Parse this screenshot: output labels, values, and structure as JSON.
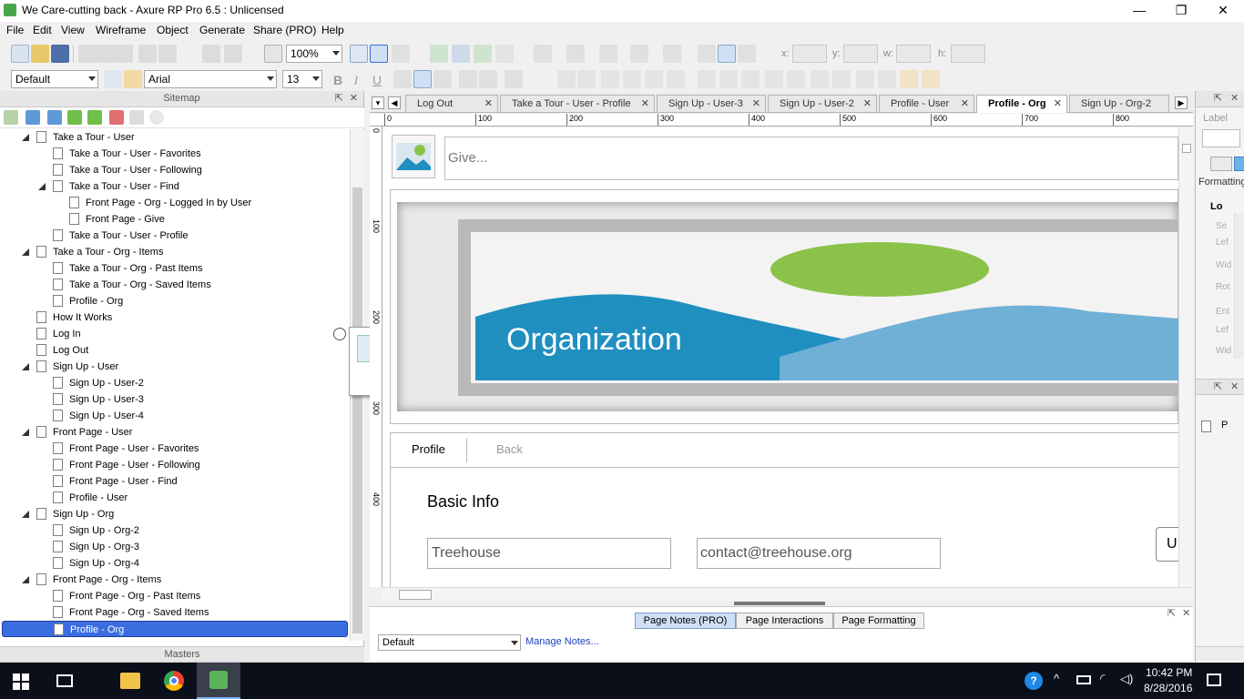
{
  "window": {
    "title": "We Care-cutting back - Axure RP Pro 6.5 : Unlicensed",
    "minimize": "—",
    "restore": "❐",
    "close": "✕"
  },
  "menu": [
    "File",
    "Edit",
    "View",
    "Wireframe",
    "Object",
    "Generate",
    "Share (PRO)",
    "Help"
  ],
  "toolbar": {
    "zoom": "100%",
    "style_combo": "Default",
    "font_combo": "Arial",
    "size_combo": "13",
    "bold": "B",
    "italic": "I",
    "underline": "U",
    "x_label": "x:",
    "y_label": "y:",
    "w_label": "w:",
    "h_label": "h:"
  },
  "sitemap": {
    "header": "Sitemap",
    "items": [
      {
        "label": "Take a Tour - User",
        "level": 1,
        "expanded": true
      },
      {
        "label": "Take a Tour - User - Favorites",
        "level": 2
      },
      {
        "label": "Take a Tour - User - Following",
        "level": 2
      },
      {
        "label": "Take a Tour - User - Find",
        "level": 2,
        "expanded": true
      },
      {
        "label": "Front Page - Org - Logged In by User",
        "level": 3
      },
      {
        "label": "Front Page - Give",
        "level": 3
      },
      {
        "label": "Take a Tour - User - Profile",
        "level": 2
      },
      {
        "label": "Take a Tour - Org - Items",
        "level": 1,
        "expanded": true
      },
      {
        "label": "Take a Tour - Org - Past Items",
        "level": 2
      },
      {
        "label": "Take a Tour - Org - Saved Items",
        "level": 2
      },
      {
        "label": "Profile - Org",
        "level": 2
      },
      {
        "label": "How It Works",
        "level": 1
      },
      {
        "label": "Log In",
        "level": 1
      },
      {
        "label": "Log Out",
        "level": 1
      },
      {
        "label": "Sign Up - User",
        "level": 1,
        "expanded": true
      },
      {
        "label": "Sign Up - User-2",
        "level": 2
      },
      {
        "label": "Sign Up - User-3",
        "level": 2
      },
      {
        "label": "Sign Up - User-4",
        "level": 2
      },
      {
        "label": "Front Page - User",
        "level": 1,
        "expanded": true
      },
      {
        "label": "Front Page - User - Favorites",
        "level": 2
      },
      {
        "label": "Front Page - User - Following",
        "level": 2
      },
      {
        "label": "Front Page - User - Find",
        "level": 2
      },
      {
        "label": "Profile - User",
        "level": 2
      },
      {
        "label": "Sign Up - Org",
        "level": 1,
        "expanded": true
      },
      {
        "label": "Sign Up - Org-2",
        "level": 2
      },
      {
        "label": "Sign Up - Org-3",
        "level": 2
      },
      {
        "label": "Sign Up - Org-4",
        "level": 2
      },
      {
        "label": "Front Page - Org - Items",
        "level": 1,
        "expanded": true
      },
      {
        "label": "Front Page - Org - Past Items",
        "level": 2
      },
      {
        "label": "Front Page - Org - Saved Items",
        "level": 2
      },
      {
        "label": "Profile - Org",
        "level": 2,
        "selected": true
      }
    ],
    "masters_header": "Masters"
  },
  "tabs": [
    {
      "label": "Log Out"
    },
    {
      "label": "Take a Tour - User - Profile"
    },
    {
      "label": "Sign Up - User-3"
    },
    {
      "label": "Sign Up - User-2"
    },
    {
      "label": "Profile - User"
    },
    {
      "label": "Profile - Org",
      "active": true
    },
    {
      "label": "Sign Up - Org-2"
    }
  ],
  "ruler": {
    "h_ticks": [
      "0",
      "100",
      "200",
      "300",
      "400",
      "500",
      "600",
      "700",
      "800"
    ],
    "v_ticks": [
      "0",
      "100",
      "200",
      "300",
      "400"
    ]
  },
  "canvas": {
    "give_placeholder": "Give...",
    "banner_title": "Organization",
    "tab_profile": "Profile",
    "tab_back": "Back",
    "section_title": "Basic Info",
    "name_value": "Treehouse",
    "email_value": "contact@treehouse.org",
    "partial_button": "U"
  },
  "notes": {
    "tab_page_notes": "Page Notes (PRO)",
    "tab_page_interactions": "Page Interactions",
    "tab_page_formatting": "Page Formatting",
    "notes_combo": "Default",
    "manage_notes": "Manage Notes..."
  },
  "right_panel": {
    "label_field": "Label",
    "formatting_tab": "Formatting",
    "cut_labels": [
      "Lo",
      "Se",
      "Lef",
      "Wid",
      "Rot",
      "Ent",
      "Lef",
      "Wid"
    ],
    "page_item": "P"
  },
  "taskbar": {
    "time": "10:42 PM",
    "date": "8/28/2016"
  },
  "colors": {
    "accent_selected": "#3a6ddf",
    "banner_blue": "#1f8fc0",
    "banner_green": "#8bc34a"
  }
}
